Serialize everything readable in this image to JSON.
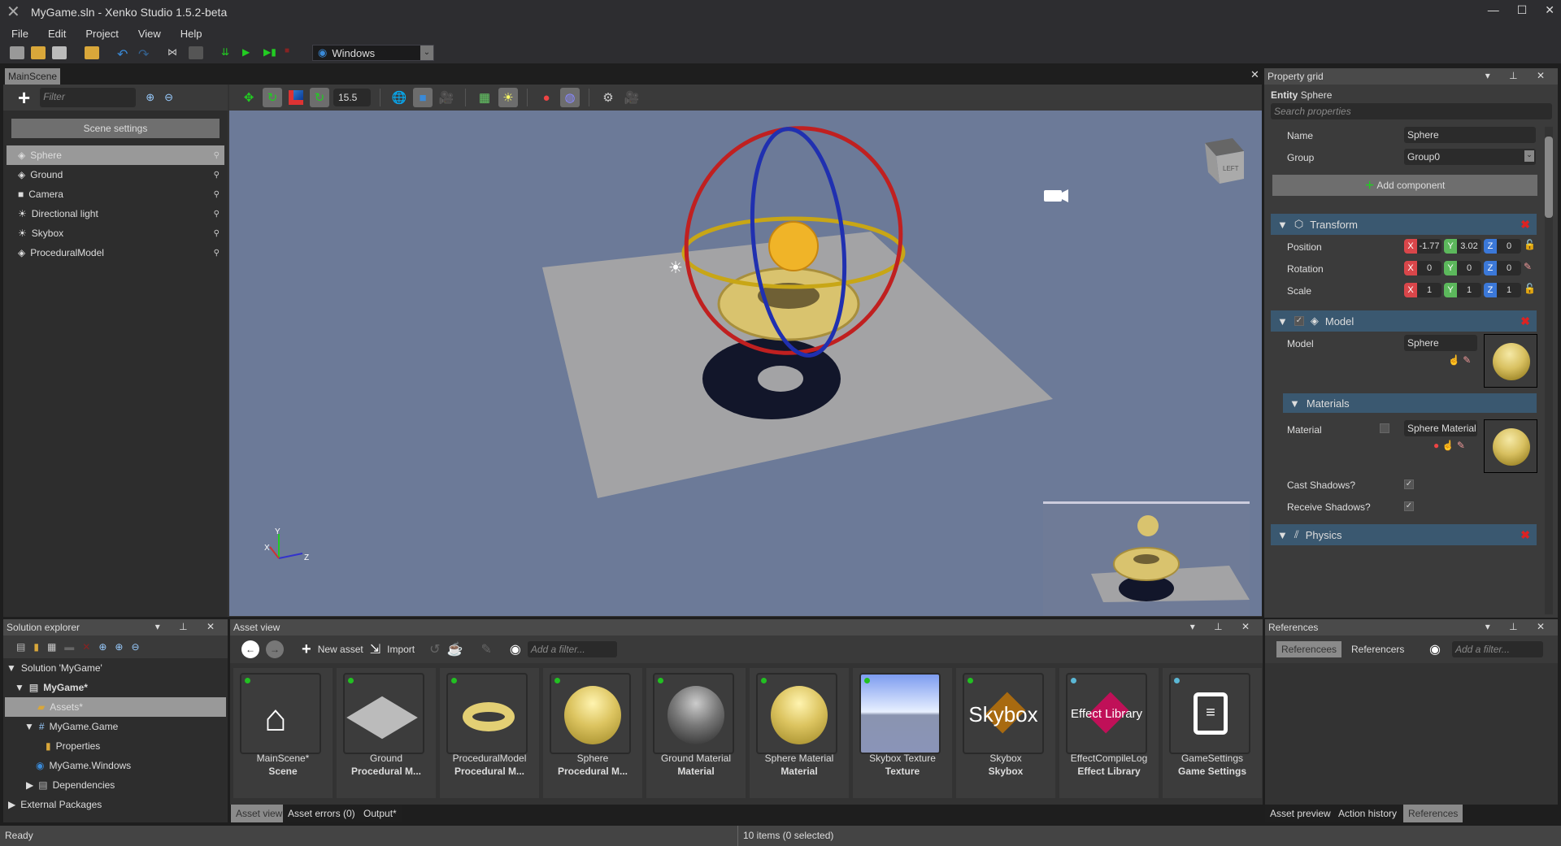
{
  "window": {
    "title": "MyGame.sln - Xenko Studio 1.5.2-beta",
    "controls": [
      "—",
      "☐",
      "✕"
    ]
  },
  "menu": [
    "File",
    "Edit",
    "Project",
    "View",
    "Help"
  ],
  "toolbar": {
    "platform": "Windows"
  },
  "document": {
    "tab": "MainScene",
    "close": "✕"
  },
  "scene": {
    "filter_placeholder": "Filter",
    "settings_button": "Scene settings",
    "entities": [
      {
        "name": "Sphere",
        "icon": "model-icon"
      },
      {
        "name": "Ground",
        "icon": "model-icon"
      },
      {
        "name": "Camera",
        "icon": "camera-icon"
      },
      {
        "name": "Directional light",
        "icon": "light-icon"
      },
      {
        "name": "Skybox",
        "icon": "light-icon"
      },
      {
        "name": "ProceduralModel",
        "icon": "model-icon"
      }
    ]
  },
  "viewport": {
    "fov": "15.5",
    "view_cube_label": "LEFT",
    "axes": [
      "X",
      "Y",
      "Z"
    ]
  },
  "property_grid": {
    "title": "Property grid",
    "entity_label": "Entity",
    "entity_name": "Sphere",
    "search_placeholder": "Search properties",
    "name_label": "Name",
    "name_value": "Sphere",
    "group_label": "Group",
    "group_value": "Group0",
    "add_component": "Add component",
    "transform": {
      "title": "Transform",
      "position_label": "Position",
      "position": [
        "-1.77",
        "3.02",
        "0"
      ],
      "rotation_label": "Rotation",
      "rotation": [
        "0",
        "0",
        "0"
      ],
      "scale_label": "Scale",
      "scale": [
        "1",
        "1",
        "1"
      ]
    },
    "model": {
      "title": "Model",
      "model_label": "Model",
      "model_value": "Sphere",
      "materials_title": "Materials",
      "material_label": "Material",
      "material_value": "Sphere Material",
      "cast_shadows_label": "Cast Shadows?",
      "cast_shadows": true,
      "receive_shadows_label": "Receive Shadows?",
      "receive_shadows": true
    },
    "physics": {
      "title": "Physics"
    },
    "colors": {
      "x": "#d9464a",
      "y": "#5cb85c",
      "z": "#3b78d8",
      "section": "#3a5870"
    }
  },
  "solution": {
    "title": "Solution explorer",
    "items": [
      "Solution 'MyGame'",
      "MyGame*",
      "Assets*",
      "MyGame.Game",
      "Properties",
      "MyGame.Windows",
      "Dependencies",
      "External Packages"
    ]
  },
  "assets": {
    "title": "Asset view",
    "new_asset": "New asset",
    "import": "Import",
    "filter_placeholder": "Add a filter...",
    "items": [
      {
        "name": "MainScene*",
        "type": "Scene",
        "status": "#22c022"
      },
      {
        "name": "Ground",
        "type": "Procedural M...",
        "status": "#22c022"
      },
      {
        "name": "ProceduralModel",
        "type": "Procedural M...",
        "status": "#22c022"
      },
      {
        "name": "Sphere",
        "type": "Procedural M...",
        "status": "#22c022"
      },
      {
        "name": "Ground Material",
        "type": "Material",
        "status": "#22c022"
      },
      {
        "name": "Sphere Material",
        "type": "Material",
        "status": "#22c022"
      },
      {
        "name": "Skybox Texture",
        "type": "Texture",
        "status": "#22c022"
      },
      {
        "name": "Skybox",
        "type": "Skybox",
        "status": "#22c022",
        "thumb_text": "Skybox"
      },
      {
        "name": "EffectCompileLog",
        "type": "Effect Library",
        "status": "#5bb8d6",
        "thumb_text": "Effect Library"
      },
      {
        "name": "GameSettings",
        "type": "Game Settings",
        "status": "#5bb8d6"
      }
    ],
    "tabs": [
      "Asset view",
      "Asset errors (0)",
      "Output*"
    ]
  },
  "references": {
    "title": "References",
    "tabs": [
      "Referencees",
      "Referencers"
    ],
    "filter_placeholder": "Add a filter...",
    "bottom_tabs": [
      "Asset preview",
      "Action history",
      "References"
    ]
  },
  "status": {
    "left": "Ready",
    "center": "10 items (0 selected)"
  }
}
